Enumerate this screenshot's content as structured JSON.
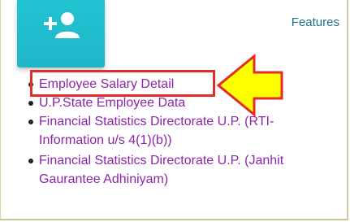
{
  "header": {
    "features_link": "Features"
  },
  "tile": {
    "icon": "add-user-icon",
    "color": "#22c3d3"
  },
  "links": [
    {
      "label": "Employee Salary Detail"
    },
    {
      "label": "U.P.State Employee Data"
    },
    {
      "label": "Financial Statistics Directorate U.P. (RTI-Information u/s 4(1)(b))"
    },
    {
      "label": "Financial Statistics Directorate U.P. (Janhit Gaurantee Adhiniyam)"
    }
  ],
  "annotation": {
    "highlight_color": "#e52a2a",
    "arrow_color": "#ffff00",
    "arrow_icon": "left-arrow-icon"
  }
}
